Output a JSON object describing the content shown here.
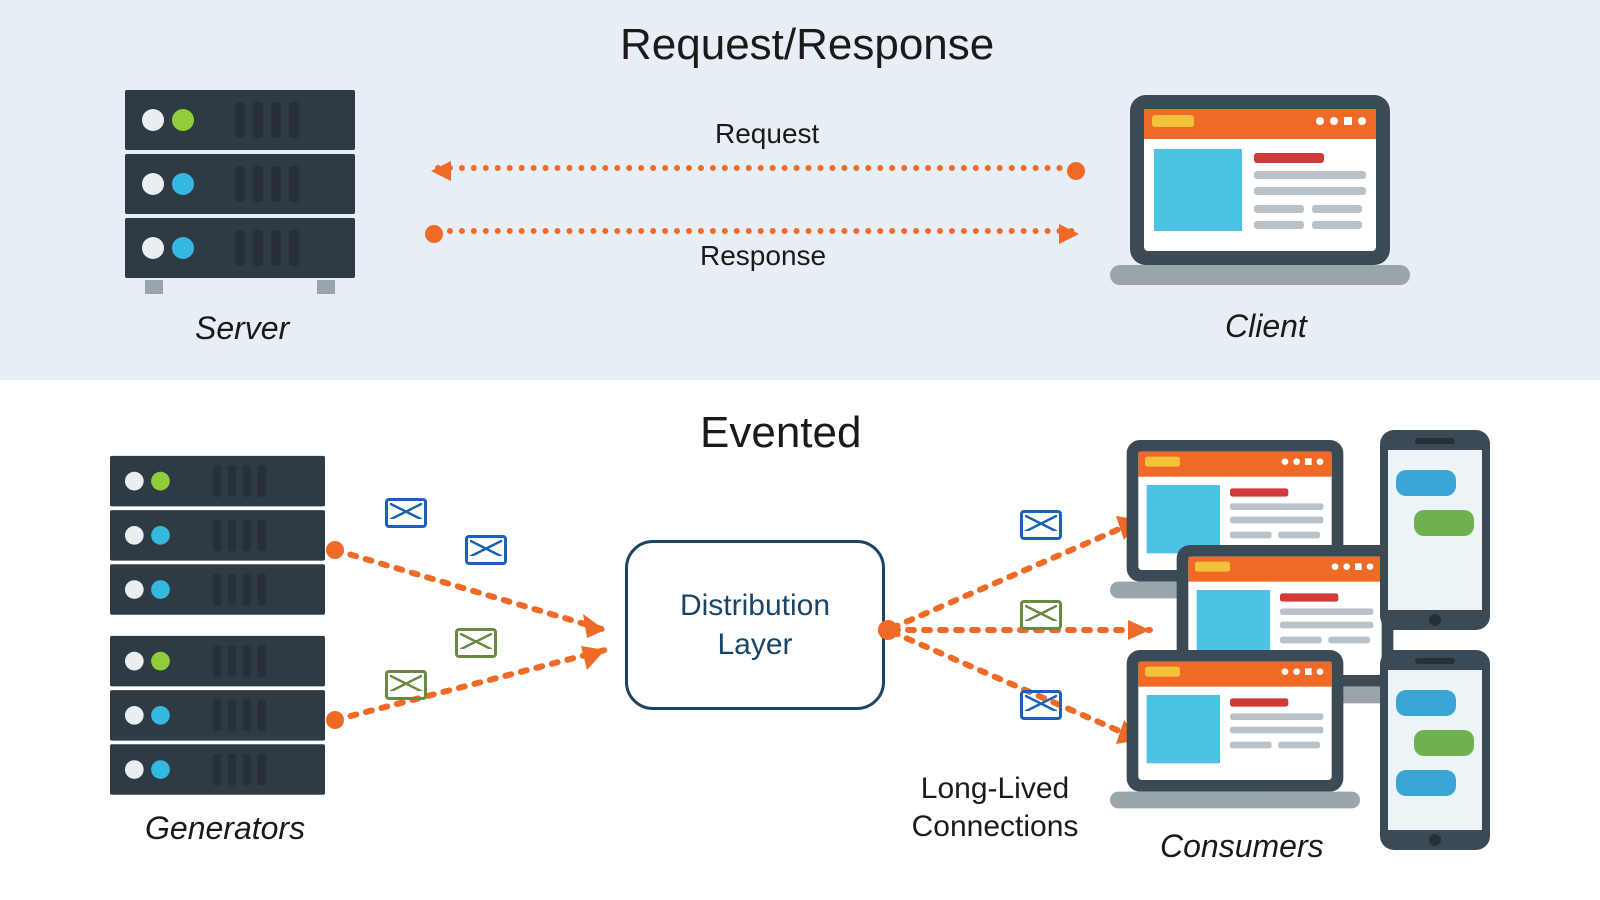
{
  "colors": {
    "accent": "#ee6a26",
    "hub_border": "#1a4566",
    "top_bg": "#e8eef6"
  },
  "top_section": {
    "title": "Request/Response",
    "request_label": "Request",
    "response_label": "Response",
    "server_label": "Server",
    "client_label": "Client"
  },
  "bottom_section": {
    "title": "Evented",
    "hub_label": "Distribution\nLayer",
    "generators_label": "Generators",
    "consumers_label": "Consumers",
    "connections_label": "Long-Lived\nConnections"
  },
  "icon_names": {
    "server": "server-stack-icon",
    "client": "laptop-browser-icon",
    "phone": "smartphone-chat-icon",
    "envelope": "envelope-icon"
  }
}
